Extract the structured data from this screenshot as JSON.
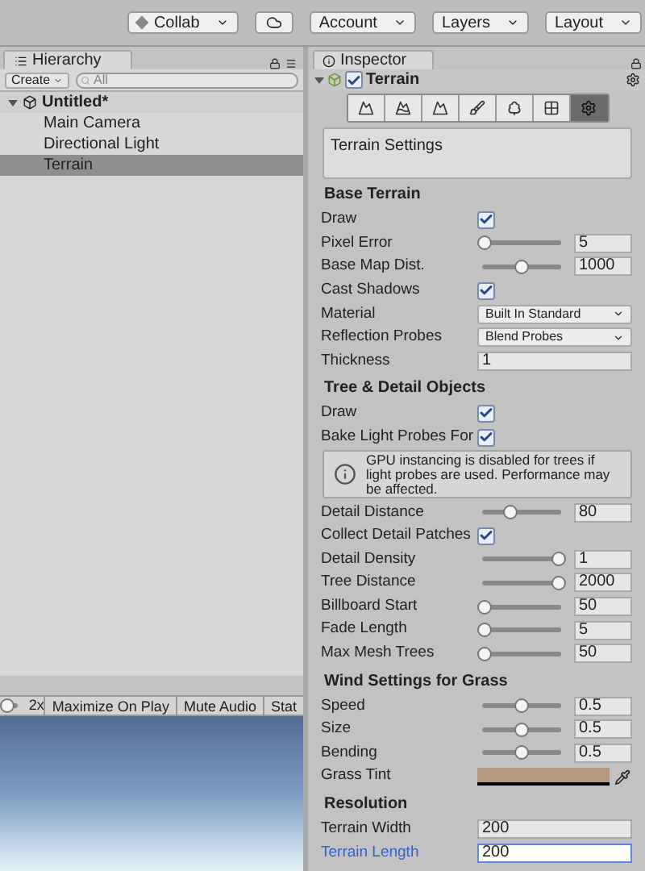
{
  "toolbar": {
    "buttons": [
      {
        "label": "Collab",
        "kind": "dropdown"
      },
      {
        "kind": "cloud"
      },
      {
        "label": "Account",
        "kind": "dropdown"
      },
      {
        "label": "Layers",
        "kind": "dropdown"
      },
      {
        "label": "Layout",
        "kind": "dropdown"
      }
    ]
  },
  "hierarchy": {
    "tab": "Hierarchy",
    "create": "Create",
    "search": {
      "placeholder": "All"
    },
    "tree": [
      {
        "label": "Untitled*",
        "expanded": true,
        "selected": false,
        "children": [
          {
            "label": "Main Camera",
            "selected": false
          },
          {
            "label": "Directional Light",
            "selected": false
          },
          {
            "label": "Terrain",
            "selected": true
          }
        ]
      }
    ]
  },
  "game_toolbar": {
    "scale_slider": {
      "level": 0.05
    },
    "scale": "2x",
    "buttons": [
      "Maximize On Play",
      "Mute Audio",
      "Stat"
    ]
  },
  "inspector": {
    "tab": "Inspector",
    "object": {
      "name": "Terrain",
      "enabled": true
    },
    "tools": [
      {
        "selected": false
      },
      {
        "selected": false
      },
      {
        "selected": false
      },
      {
        "selected": false
      },
      {
        "selected": false
      },
      {
        "selected": false
      },
      {
        "selected": true
      }
    ],
    "description": "Terrain Settings",
    "rows": [
      {
        "kind": "header",
        "label": "Base Terrain"
      },
      {
        "kind": "checkbox",
        "label": "Draw",
        "checked": true
      },
      {
        "kind": "slider",
        "label": "Pixel Error",
        "level": 0,
        "value": "5"
      },
      {
        "kind": "slider",
        "label": "Base Map Dist.",
        "level": 0.5,
        "value": "1000"
      },
      {
        "kind": "checkbox",
        "label": "Cast Shadows",
        "checked": true
      },
      {
        "kind": "dropdown",
        "label": "Material",
        "value": "Built In Standard"
      },
      {
        "kind": "dropdown",
        "label": "Reflection Probes",
        "value": "Blend Probes"
      },
      {
        "kind": "field",
        "label": "Thickness",
        "value": "1",
        "focused": false
      },
      {
        "kind": "header",
        "label": "Tree & Detail Objects"
      },
      {
        "kind": "checkbox",
        "label": "Draw",
        "checked": true
      },
      {
        "kind": "checkbox",
        "label": "Bake Light Probes For",
        "checked": true
      },
      {
        "kind": "help",
        "label": "GPU instancing is disabled for trees if light probes are used. Performance may be affected."
      },
      {
        "kind": "slider",
        "label": "Detail Distance",
        "level": 0.35,
        "value": "80"
      },
      {
        "kind": "checkbox",
        "label": "Collect Detail Patches",
        "checked": true
      },
      {
        "kind": "slider",
        "label": "Detail Density",
        "level": 1,
        "value": "1"
      },
      {
        "kind": "slider",
        "label": "Tree Distance",
        "level": 1,
        "value": "2000"
      },
      {
        "kind": "slider",
        "label": "Billboard Start",
        "level": 0,
        "value": "50"
      },
      {
        "kind": "slider",
        "label": "Fade Length",
        "level": 0,
        "value": "5"
      },
      {
        "kind": "slider",
        "label": "Max Mesh Trees",
        "level": 0,
        "value": "50"
      },
      {
        "kind": "header",
        "label": "Wind Settings for Grass"
      },
      {
        "kind": "slider",
        "label": "Speed",
        "level": 0.5,
        "value": "0.5"
      },
      {
        "kind": "slider",
        "label": "Size",
        "level": 0.5,
        "value": "0.5"
      },
      {
        "kind": "slider",
        "label": "Bending",
        "level": 0.5,
        "value": "0.5"
      },
      {
        "kind": "color",
        "label": "Grass Tint",
        "color": "#b59880"
      },
      {
        "kind": "header",
        "label": "Resolution"
      },
      {
        "kind": "field",
        "label": "Terrain Width",
        "value": "200",
        "focused": false
      },
      {
        "kind": "field",
        "label": "Terrain Length",
        "value": "200",
        "focused": true
      }
    ]
  }
}
